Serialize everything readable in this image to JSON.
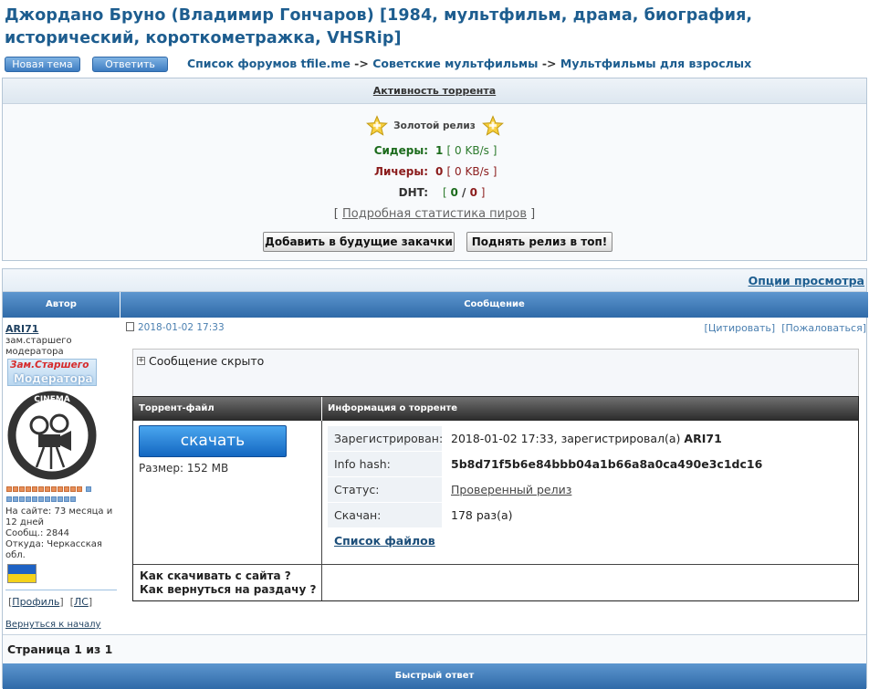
{
  "topic": {
    "title": "Джордано Бруно (Владимир Гончаров) [1984, мультфильм, драма, биография, исторический, короткометражка, VHSRip]"
  },
  "toolbar": {
    "new_topic": "Новая тема",
    "reply": "Ответить"
  },
  "breadcrumb": {
    "items": [
      "Список форумов tfile.me",
      "Советские мультфильмы",
      "Мультфильмы для взрослых"
    ],
    "separator": "->"
  },
  "activity": {
    "header": "Активность торрента",
    "gold_release": "Золотой релиз",
    "seeders_label": "Сидеры:",
    "seeders_count": "1",
    "seeders_speed": "0 KB/s",
    "leechers_label": "Личеры:",
    "leechers_count": "0",
    "leechers_speed": "0 KB/s",
    "dht_label": "DHT:",
    "dht_seeders": "0",
    "dht_leechers": "0",
    "stats_link": "Подробная статистика пиров",
    "add_future_btn": "Добавить в будущие закачки",
    "bump_btn": "Поднять релиз в топ!"
  },
  "post_table": {
    "view_options": "Опции просмотра",
    "col_author": "Автор",
    "col_message": "Сообщение"
  },
  "author": {
    "nick": "ARI71",
    "rank": "зам.старшего модератора",
    "rank_badge_line1": "Зам.Старшего",
    "rank_badge_line2": "Модератора",
    "avatar_text": "CINEMA",
    "on_site": "На сайте: 73 месяца и 12 дней",
    "posts": "Сообщ.: 2844",
    "from": "Откуда: Черкасская обл.",
    "profile_link": "Профиль",
    "pm_link": "ЛС",
    "back_to_top": "Вернуться к началу"
  },
  "post": {
    "date": "2018-01-02 17:33",
    "quote": "Цитировать",
    "report": "Пожаловаться",
    "spoiler_title": "Сообщение скрыто"
  },
  "torrent": {
    "file_header": "Торрент-файл",
    "info_header": "Информация о торренте",
    "download_btn": "скачать",
    "size": "Размер: 152 MB",
    "registered_label": "Зарегистрирован:",
    "registered_value": "2018-01-02 17:33, зарегистрировал(а)",
    "registered_user": "ARI71",
    "hash_label": "Info hash:",
    "hash_value": "5b8d71f5b6e84bbb04a1b66a8a0ca490e3c1dc16",
    "status_label": "Статус:",
    "status_value": "Проверенный релиз",
    "downloaded_label": "Скачан:",
    "downloaded_value": "178 раз(а)",
    "file_list": "Список файлов",
    "faq_download": "Как скачивать с сайта ?",
    "faq_seed": "Как вернуться на раздачу ?"
  },
  "pagination": {
    "text": "Страница 1 из 1"
  },
  "quick_reply": {
    "header": "Быстрый ответ"
  },
  "colors": {
    "accent_blue": "#2f6aa8",
    "title_blue": "#1d5d8f",
    "seeders_green": "#1c6b1c",
    "leechers_red": "#8b1c1c"
  }
}
